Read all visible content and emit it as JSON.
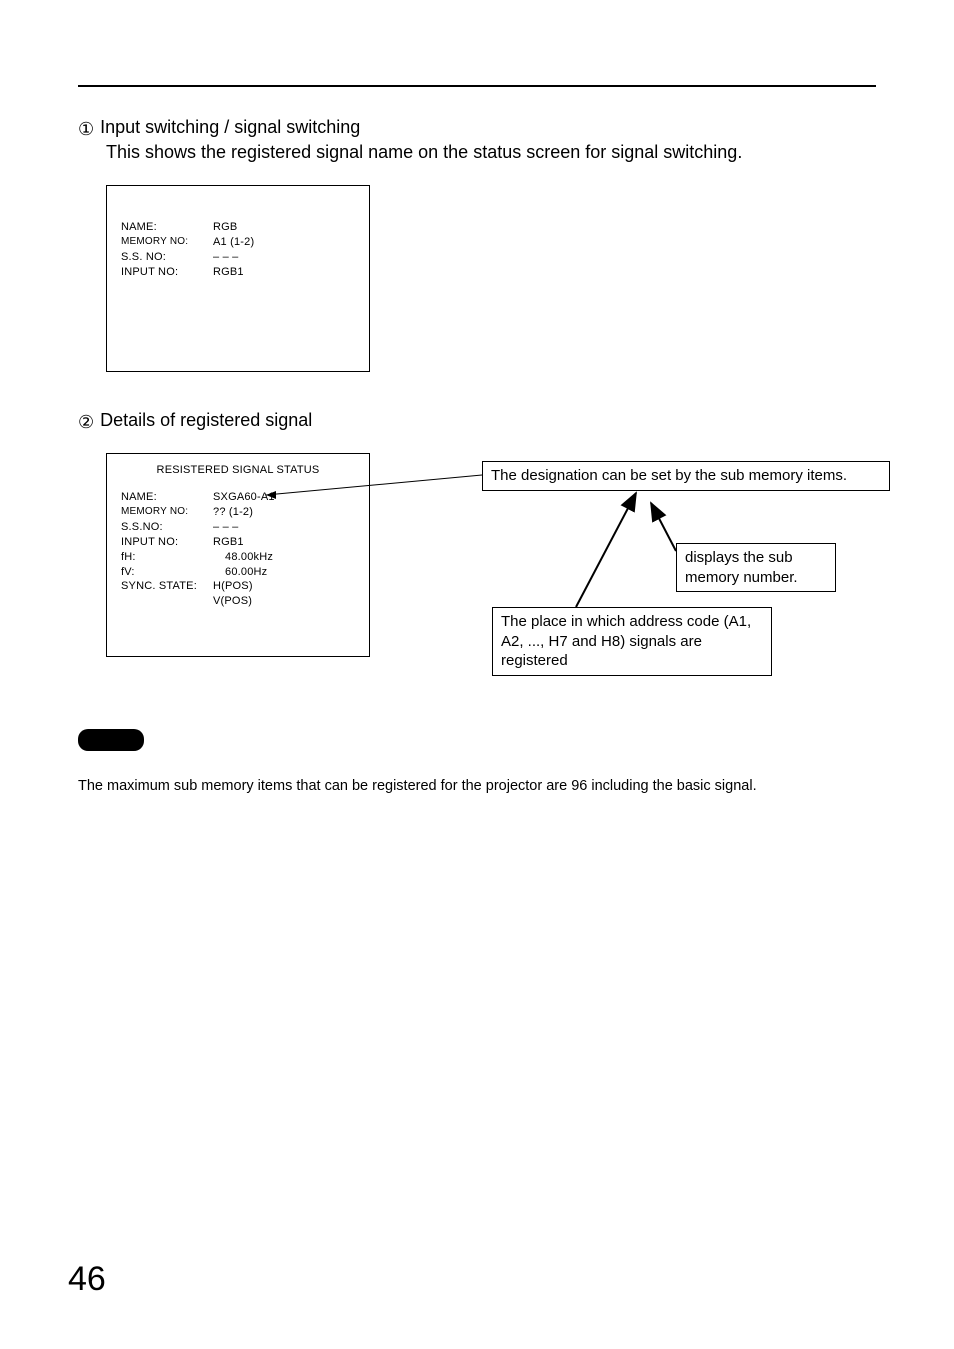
{
  "section1": {
    "marker": "①",
    "title": "Input switching / signal switching",
    "desc": "This shows the registered signal name on the status screen for signal switching.",
    "panel": {
      "rows": [
        {
          "k": "NAME:",
          "v": "RGB"
        },
        {
          "k": "MEMORY NO:",
          "v": "A1 (1-2)"
        },
        {
          "k": "S.S. NO:",
          "v": "– – –"
        },
        {
          "k": "INPUT NO:",
          "v": "RGB1"
        }
      ]
    }
  },
  "section2": {
    "marker": "②",
    "title": "Details of registered signal",
    "panel": {
      "heading": "RESISTERED SIGNAL STATUS",
      "rows": [
        {
          "k": "NAME:",
          "v": "SXGA60-A1"
        },
        {
          "k": "MEMORY NO:",
          "v": "?? (1-2)",
          "small": true
        },
        {
          "k": "S.S.NO:",
          "v": "– – –"
        },
        {
          "k": "INPUT NO:",
          "v": "RGB1"
        },
        {
          "k": "fH:",
          "v": "48.00kHz",
          "indent": true
        },
        {
          "k": "fV:",
          "v": "60.00Hz",
          "indent": true
        },
        {
          "k": "SYNC. STATE:",
          "v": "H(POS)"
        },
        {
          "k": "",
          "v": "V(POS)"
        }
      ]
    },
    "callouts": {
      "a": "The designation can be set by the sub memory items.",
      "b": "displays the sub memory number.",
      "c": "The place in which address code (A1, A2, ..., H7 and H8) signals are registered"
    }
  },
  "note": {
    "text": "The maximum sub memory items that can be registered for the projector are 96 including the basic signal."
  },
  "pageNumber": "46"
}
